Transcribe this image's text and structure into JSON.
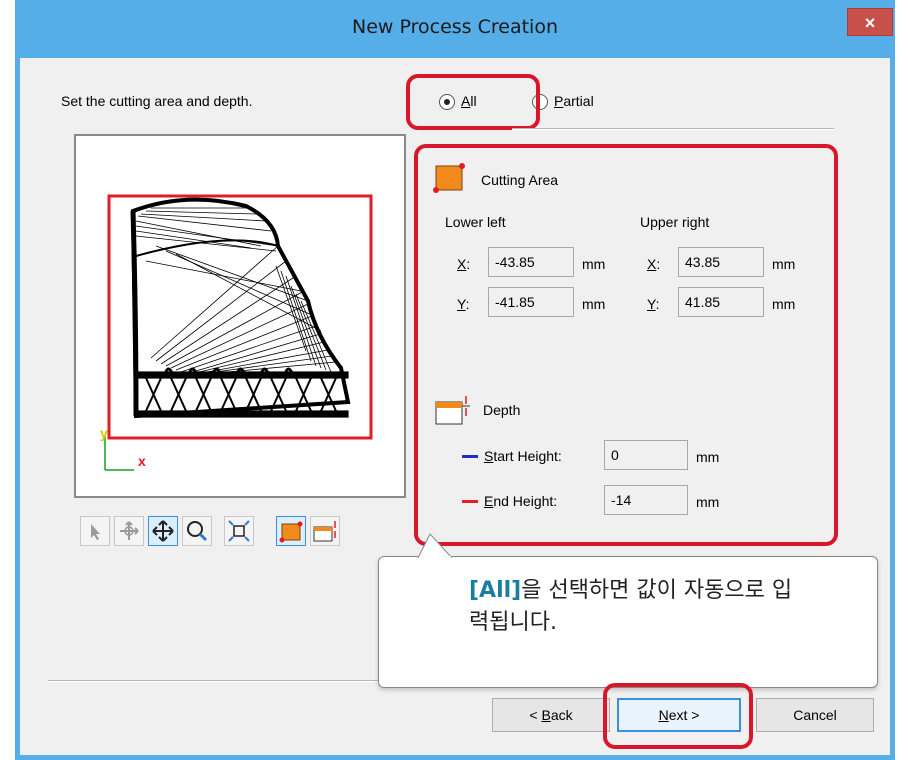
{
  "window": {
    "title": "New Process Creation",
    "close_label": "×"
  },
  "intro_label": "Set the cutting area and depth.",
  "radio_all": {
    "label": "All",
    "mnemonic": "A",
    "rest": "ll",
    "selected": true
  },
  "radio_partial": {
    "label": "Partial",
    "mnemonic": "P",
    "rest": "artial",
    "selected": false
  },
  "cutting_area": {
    "heading": "Cutting Area",
    "lower_left_label": "Lower left",
    "upper_right_label": "Upper right",
    "x_label": "X:",
    "y_label": "Y:",
    "unit": "mm",
    "lower_left_x": "-43.85",
    "lower_left_y": "-41.85",
    "upper_right_x": "43.85",
    "upper_right_y": "41.85"
  },
  "depth": {
    "heading": "Depth",
    "start_height_label": "Start Height:",
    "start_height_mnemonic": "S",
    "start_height_rest": "tart Height:",
    "start_height_value": "0",
    "end_height_label": "End Height:",
    "end_height_mnemonic": "E",
    "end_height_rest": "nd Height:",
    "end_height_value": "-14",
    "unit": "mm",
    "start_line_color": "#1a2ed0",
    "end_line_color": "#e0202a"
  },
  "preview": {
    "axis_y": "y",
    "axis_x": "x"
  },
  "toolbar": {
    "icons": [
      "select-arrow-icon",
      "rotate-move-icon",
      "pan-icon",
      "zoom-icon",
      "fit-view-icon",
      "cutting-area-icon",
      "depth-icon"
    ]
  },
  "callout": {
    "highlight": "[All]",
    "text": "을 선택하면 값이 자동으로 입력됩니다."
  },
  "buttons": {
    "back": "< Back",
    "back_mnemonic": "B",
    "next": "Next >",
    "next_mnemonic": "N",
    "cancel": "Cancel"
  },
  "colors": {
    "title_bar": "#56aee8",
    "highlight_red": "#d8182a",
    "callout_accent": "#1b7ea0",
    "cutting_area_orange": "#f08a1c"
  }
}
